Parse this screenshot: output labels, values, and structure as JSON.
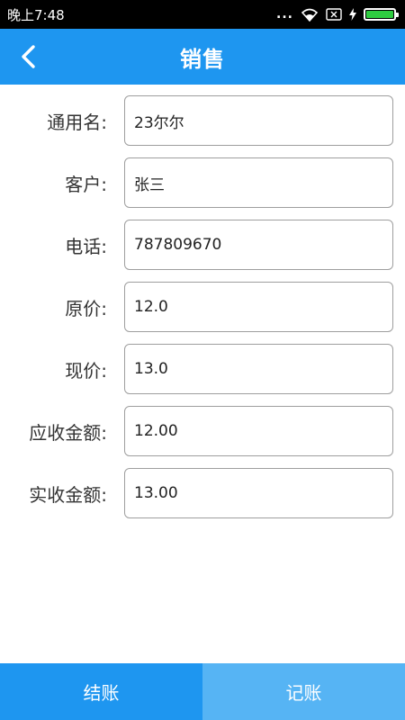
{
  "status_bar": {
    "time": "晚上7:48",
    "dots": "...",
    "icons": [
      "wifi-icon",
      "sim-x-icon",
      "charging-icon",
      "battery-icon"
    ],
    "battery_level": 1.0
  },
  "header": {
    "title": "销售",
    "back_icon": "chevron-left-icon"
  },
  "form": {
    "generic_name": {
      "label": "通用名:",
      "value": "23尔尔"
    },
    "customer": {
      "label": "客户:",
      "value": "张三"
    },
    "phone": {
      "label": "电话:",
      "value": "787809670"
    },
    "original_price": {
      "label": "原价:",
      "value": "12.0"
    },
    "current_price": {
      "label": "现价:",
      "value": "13.0"
    },
    "amount_receivable": {
      "label": "应收金额:",
      "value": "12.00"
    },
    "amount_received": {
      "label": "实收金额:",
      "value": "13.00"
    }
  },
  "footer": {
    "checkout_label": "结账",
    "record_label": "记账"
  },
  "colors": {
    "primary": "#1e96f0",
    "secondary_button": "#56b4f4",
    "battery": "#2ecc40"
  }
}
